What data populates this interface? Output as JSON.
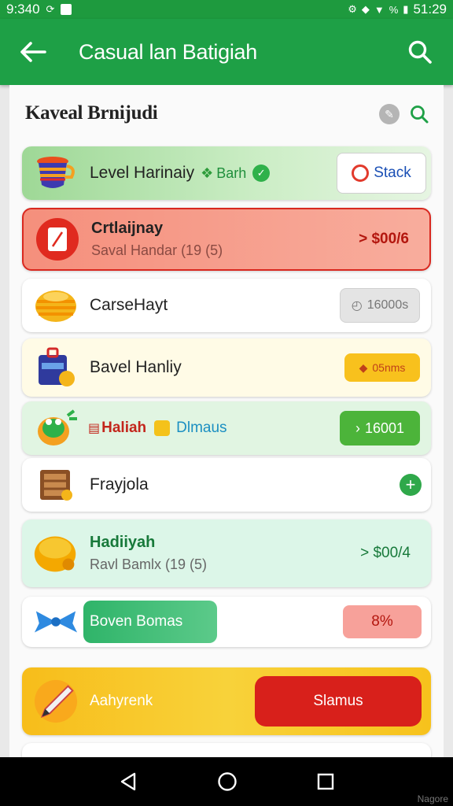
{
  "status_bar": {
    "time_left": "9:340",
    "time_right": "51:29",
    "percent": "%"
  },
  "app_bar": {
    "title": "Casual lan Batigiah"
  },
  "section": {
    "title": "Kaveal Brnijudi"
  },
  "rows": [
    {
      "label": "Level Harinaiy",
      "tag": "Barh",
      "action": "Stack",
      "icon": "cup-icon"
    },
    {
      "label": "Crtlaijnay",
      "sub": "Saval Handar (19 (5)",
      "value": "> $00/6",
      "icon": "note-icon"
    },
    {
      "label": "CarseHayt",
      "value": "16000s",
      "icon": "coin-stack-icon"
    },
    {
      "label": "Bavel Hanliy",
      "value": "05nms",
      "icon": "box-icon"
    },
    {
      "label": "Haliah",
      "label2": "Dlmaus",
      "value": "16001",
      "icon": "frog-icon"
    },
    {
      "label": "Frayjola",
      "icon": "crate-icon"
    },
    {
      "label": "Hadiiyah",
      "sub": "Ravl Bamlx (19 (5)",
      "value": "> $00/4",
      "icon": "ball-icon"
    },
    {
      "button": "Boven Bomas",
      "value": "8%",
      "icon": "bow-icon"
    },
    {
      "label": "Aahyrenk",
      "button": "Slamus",
      "icon": "pencil-icon"
    }
  ],
  "watermark": "Nagore",
  "colors": {
    "green_bar": "#1ea046",
    "row1_bg": "#c6e9c0",
    "row2_bg": "#f7a494",
    "row2_border": "#d9281f",
    "row5_bg": "#e1f5e2",
    "row7_bg": "#dcf6e8",
    "banner_bg": "#f5c62a",
    "red_button": "#d8201b"
  }
}
